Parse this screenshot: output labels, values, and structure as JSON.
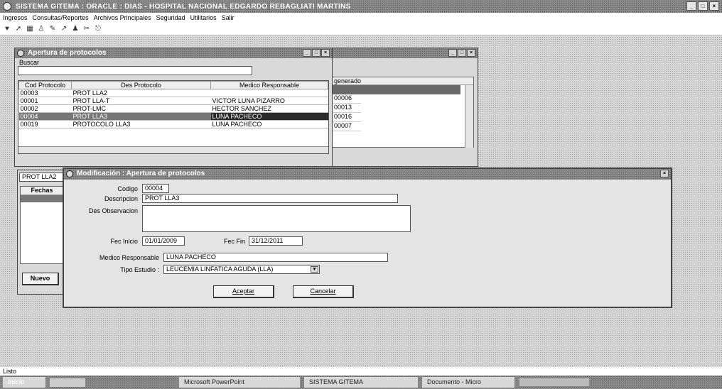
{
  "app": {
    "title": "SISTEMA GITEMA : ORACLE : DIAS - HOSPITAL NACIONAL EDGARDO REBAGLIATI MARTINS"
  },
  "menu": [
    "Ingresos",
    "Consultas/Reportes",
    "Archivos Principales",
    "Seguridad",
    "Utilitarios",
    "Salir"
  ],
  "toolbar_icons": [
    "heart-icon",
    "pointer-icon",
    "grid-icon",
    "people-icon",
    "pen-icon",
    "arrow-icon",
    "group-icon",
    "scissors-icon",
    "exit-icon"
  ],
  "protocol_window": {
    "title": "Apertura de protocolos",
    "search_label": "Buscar",
    "search_value": "",
    "columns": [
      "Cod Protocolo",
      "Des Protocolo",
      "Medico Responsable"
    ],
    "rows": [
      {
        "cod": "00003",
        "des": "PROT LLA2",
        "med": ""
      },
      {
        "cod": "00001",
        "des": "PROT LLA-T",
        "med": "VICTOR LUNA PIZARRO"
      },
      {
        "cod": "00002",
        "des": "PROT-LMC",
        "med": "HECTOR SANCHEZ"
      },
      {
        "cod": "00004",
        "des": "PROT LLA3",
        "med": "LUNA PACHECO"
      },
      {
        "cod": "00019",
        "des": "PROTOCOLO LLA3",
        "med": "LUNA PACHECO"
      }
    ],
    "selected_row": 3
  },
  "second_window": {
    "column": "generado",
    "rows": [
      "",
      "00006",
      "00013",
      "00016",
      "00007"
    ]
  },
  "left_panel": {
    "protocol_label": "PROT LLA2",
    "fechas_header": "Fechas",
    "new_button": "Nuevo"
  },
  "modal": {
    "title": "Modificación : Apertura de protocolos",
    "codigo_label": "Codigo",
    "codigo_value": "00004",
    "descripcion_label": "Descripcion",
    "descripcion_value": "PROT LLA3",
    "observacion_label": "Des Observacion",
    "observacion_value": "",
    "fec_inicio_label": "Fec Inicio",
    "fec_inicio_value": "01/01/2009",
    "fec_fin_label": "Fec Fin",
    "fec_fin_value": "31/12/2011",
    "medico_label": "Medico Responsable",
    "medico_value": "LUNA PACHECO",
    "tipo_label": "Tipo Estudio :",
    "tipo_value": "LEUCEMIA LINFATICA AGUDA (LLA)",
    "accept_label": "Aceptar",
    "cancel_label": "Cancelar"
  },
  "status": {
    "text": "Listo"
  },
  "taskbar": {
    "start_label": "Inicio",
    "tasks": [
      "Microsoft PowerPoint",
      "SISTEMA GITEMA",
      "Documento - Micro"
    ]
  }
}
